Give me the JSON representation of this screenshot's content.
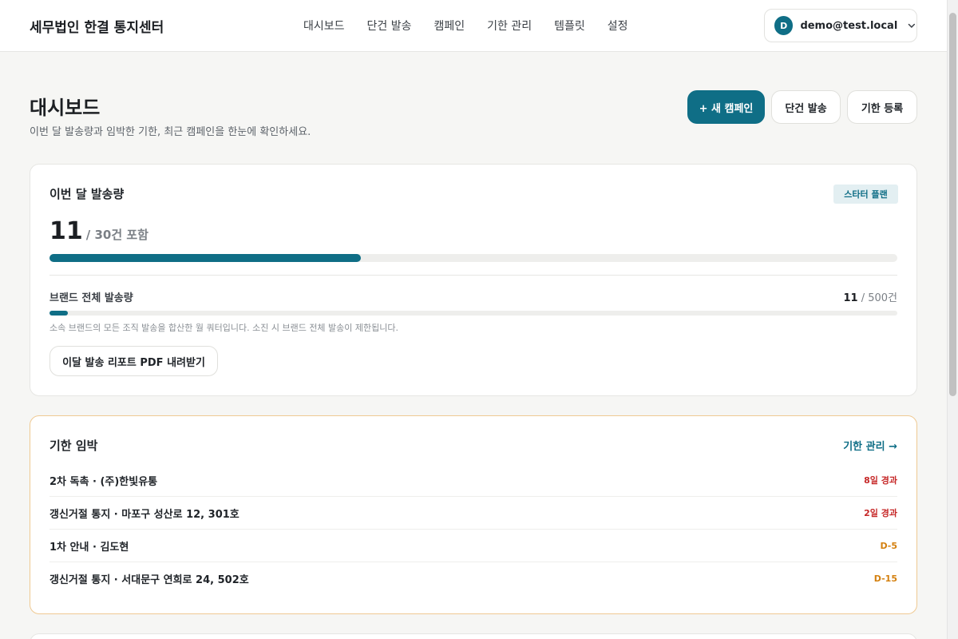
{
  "app": {
    "title": "세무법인 한결 통지센터"
  },
  "nav": {
    "items": [
      {
        "label": "대시보드"
      },
      {
        "label": "단건 발송"
      },
      {
        "label": "캠페인"
      },
      {
        "label": "기한 관리"
      },
      {
        "label": "템플릿"
      },
      {
        "label": "설정"
      }
    ]
  },
  "account": {
    "initial": "D",
    "email": "demo@test.local",
    "icon": "chevron-down-icon"
  },
  "page": {
    "title": "대시보드",
    "subtitle": "이번 달 발송량과 임박한 기한, 최근 캠페인을 한눈에 확인하세요."
  },
  "actions": {
    "new_campaign": "+ 새 캠페인",
    "single_send": "단건 발송",
    "register_deadline": "기한 등록"
  },
  "usage": {
    "title": "이번 달 발송량",
    "plan_badge": "스타터 플랜",
    "count": "11",
    "limit": "/ 30건 포함",
    "progress_fraction": 0.367,
    "brand_label": "브랜드 전체 발송량",
    "brand_count": "11",
    "brand_limit": "/ 500건",
    "brand_progress_fraction": 0.022,
    "note": "소속 브랜드의 모든 조직 발송을 합산한 월 쿼터입니다. 소진 시 브랜드 전체 발송이 제한됩니다.",
    "report_button": "이달 발송 리포트 PDF 내려받기"
  },
  "deadlines": {
    "title": "기한 임박",
    "link": "기한 관리 →",
    "items": [
      {
        "text": "2차 독촉 · (주)한빛유통",
        "status": "8일 경과",
        "kind": "overdue"
      },
      {
        "text": "갱신거절 통지 · 마포구 성산로 12, 301호",
        "status": "2일 경과",
        "kind": "overdue"
      },
      {
        "text": "1차 안내 · 김도현",
        "status": "D-5",
        "kind": "upcoming"
      },
      {
        "text": "갱신거절 통지 · 서대문구 연희로 24, 502호",
        "status": "D-15",
        "kind": "upcoming"
      }
    ]
  },
  "colors": {
    "accent": "#0f6e86",
    "overdue": "#c62828",
    "upcoming": "#d4800f",
    "deadline_border": "#efc992"
  }
}
